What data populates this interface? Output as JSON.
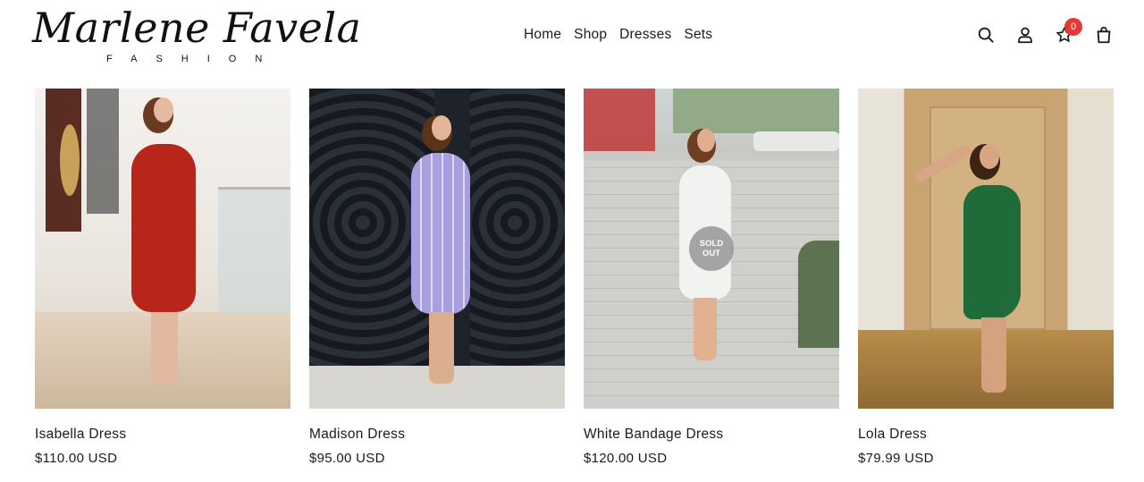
{
  "brand": {
    "name": "Marlene Favela",
    "sub": "FASHION"
  },
  "nav": {
    "items": [
      "Home",
      "Shop",
      "Dresses",
      "Sets"
    ]
  },
  "header_icons": {
    "search": "search-icon",
    "account": "user-icon",
    "wishlist": "star-icon",
    "wishlist_count": "0",
    "cart": "shopping-bag-icon"
  },
  "products": [
    {
      "title": "Isabella Dress",
      "price": "$110.00 USD",
      "dress_color": "#b8261b",
      "sold_out": false
    },
    {
      "title": "Madison Dress",
      "price": "$95.00 USD",
      "dress_color": "#a99ee0",
      "sold_out": false
    },
    {
      "title": "White Bandage Dress",
      "price": "$120.00 USD",
      "dress_color": "#f2f2f0",
      "sold_out": true,
      "sold_out_label_1": "SOLD",
      "sold_out_label_2": "OUT"
    },
    {
      "title": "Lola Dress",
      "price": "$79.99 USD",
      "dress_color": "#1f6b3a",
      "sold_out": false
    }
  ],
  "colors": {
    "badge": "#e53935",
    "text": "#1a1a1a"
  }
}
